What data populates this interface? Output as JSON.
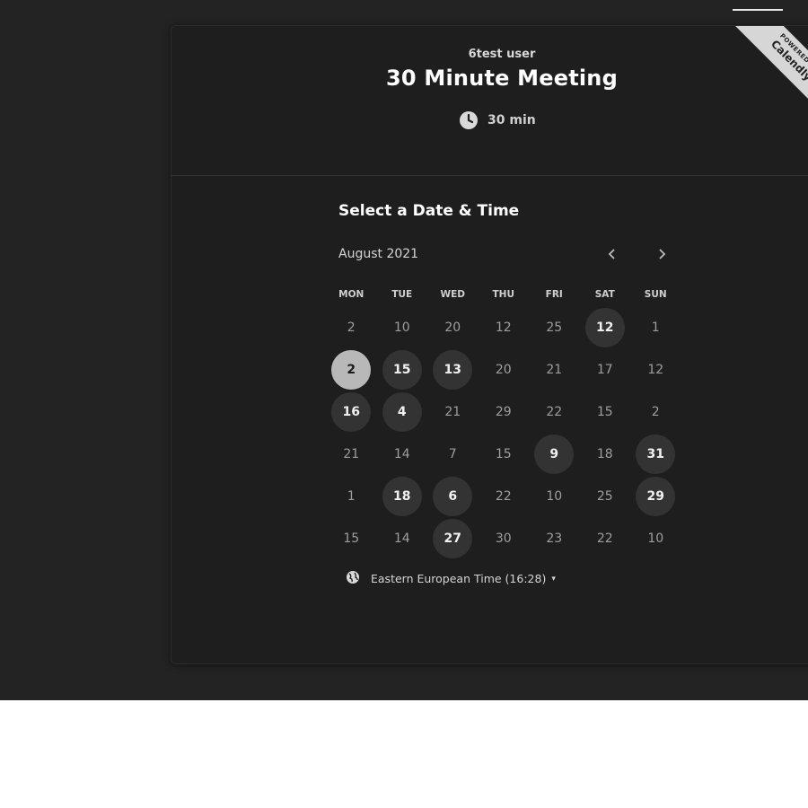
{
  "header": {
    "host": "6test user",
    "event_title": "30 Minute Meeting",
    "duration": "30 min",
    "duration_icon": "clock-icon"
  },
  "ribbon": {
    "small": "POWERED BY",
    "brand": "Calendly"
  },
  "calendar": {
    "section_title": "Select a Date & Time",
    "month_label": "August 2021",
    "prev_icon": "chevron-left-icon",
    "next_icon": "chevron-right-icon",
    "weekdays": [
      "MON",
      "TUE",
      "WED",
      "THU",
      "FRI",
      "SAT",
      "SUN"
    ],
    "weeks": [
      [
        {
          "day": "2",
          "state": "unavailable"
        },
        {
          "day": "10",
          "state": "unavailable"
        },
        {
          "day": "20",
          "state": "unavailable"
        },
        {
          "day": "12",
          "state": "unavailable"
        },
        {
          "day": "25",
          "state": "unavailable"
        },
        {
          "day": "12",
          "state": "available"
        },
        {
          "day": "1",
          "state": "unavailable"
        }
      ],
      [
        {
          "day": "2",
          "state": "selected"
        },
        {
          "day": "15",
          "state": "available"
        },
        {
          "day": "13",
          "state": "available"
        },
        {
          "day": "20",
          "state": "unavailable"
        },
        {
          "day": "21",
          "state": "unavailable"
        },
        {
          "day": "17",
          "state": "unavailable"
        },
        {
          "day": "12",
          "state": "unavailable"
        }
      ],
      [
        {
          "day": "16",
          "state": "available"
        },
        {
          "day": "4",
          "state": "available"
        },
        {
          "day": "21",
          "state": "unavailable"
        },
        {
          "day": "29",
          "state": "unavailable"
        },
        {
          "day": "22",
          "state": "unavailable"
        },
        {
          "day": "15",
          "state": "unavailable"
        },
        {
          "day": "2",
          "state": "unavailable"
        }
      ],
      [
        {
          "day": "21",
          "state": "unavailable"
        },
        {
          "day": "14",
          "state": "unavailable"
        },
        {
          "day": "7",
          "state": "unavailable"
        },
        {
          "day": "15",
          "state": "unavailable"
        },
        {
          "day": "9",
          "state": "available"
        },
        {
          "day": "18",
          "state": "unavailable"
        },
        {
          "day": "31",
          "state": "available"
        }
      ],
      [
        {
          "day": "1",
          "state": "unavailable"
        },
        {
          "day": "18",
          "state": "available"
        },
        {
          "day": "6",
          "state": "available"
        },
        {
          "day": "22",
          "state": "unavailable"
        },
        {
          "day": "10",
          "state": "unavailable"
        },
        {
          "day": "25",
          "state": "unavailable"
        },
        {
          "day": "29",
          "state": "available"
        }
      ],
      [
        {
          "day": "15",
          "state": "unavailable"
        },
        {
          "day": "14",
          "state": "unavailable"
        },
        {
          "day": "27",
          "state": "available"
        },
        {
          "day": "30",
          "state": "unavailable"
        },
        {
          "day": "23",
          "state": "unavailable"
        },
        {
          "day": "22",
          "state": "unavailable"
        },
        {
          "day": "10",
          "state": "unavailable"
        }
      ]
    ]
  },
  "timezone": {
    "label": "Eastern European Time (16:28)",
    "icon": "globe-icon",
    "caret": "▾"
  },
  "colors": {
    "page_background": "#232323",
    "card_background": "#1e1e1e",
    "available_day": "#333333",
    "selected_day": "#b8b8b8",
    "text_primary": "#ffffff"
  }
}
